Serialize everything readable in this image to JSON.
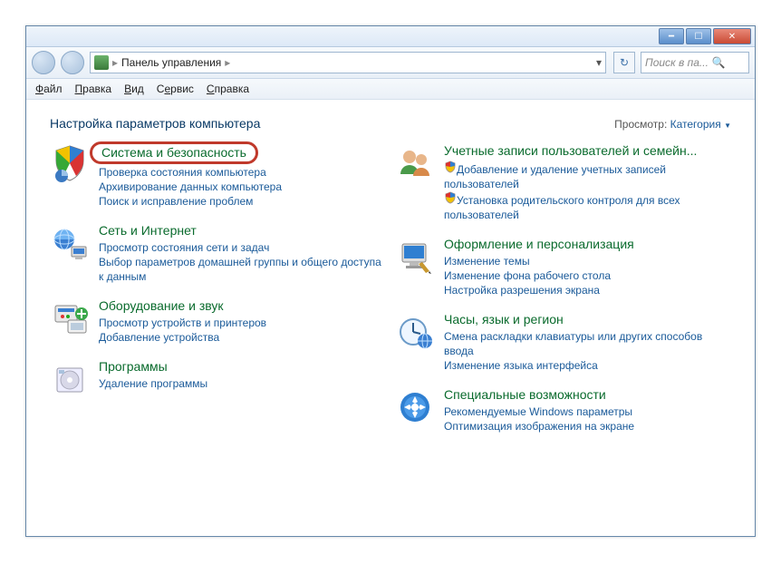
{
  "window": {
    "breadcrumb_root": "Панель управления",
    "search_placeholder": "Поиск в па..."
  },
  "menu": {
    "file": "Файл",
    "edit": "Правка",
    "view": "Вид",
    "tools": "Сервис",
    "help": "Справка"
  },
  "header": {
    "title": "Настройка параметров компьютера",
    "view_label": "Просмотр:",
    "view_value": "Категория"
  },
  "categories": {
    "left": [
      {
        "icon": "shield",
        "title": "Система и безопасность",
        "highlighted": true,
        "links": [
          "Проверка состояния компьютера",
          "Архивирование данных компьютера",
          "Поиск и исправление проблем"
        ]
      },
      {
        "icon": "network",
        "title": "Сеть и Интернет",
        "links": [
          "Просмотр состояния сети и задач",
          "Выбор параметров домашней группы и общего доступа к данным"
        ]
      },
      {
        "icon": "hardware",
        "title": "Оборудование и звук",
        "links": [
          "Просмотр устройств и принтеров",
          "Добавление устройства"
        ]
      },
      {
        "icon": "programs",
        "title": "Программы",
        "links": [
          "Удаление программы"
        ]
      }
    ],
    "right": [
      {
        "icon": "users",
        "title": "Учетные записи пользователей и семейн...",
        "links_shield": [
          "Добавление и удаление учетных записей пользователей",
          "Установка родительского контроля для всех пользователей"
        ]
      },
      {
        "icon": "appearance",
        "title": "Оформление и персонализация",
        "links": [
          "Изменение темы",
          "Изменение фона рабочего стола",
          "Настройка разрешения экрана"
        ]
      },
      {
        "icon": "clock",
        "title": "Часы, язык и регион",
        "links": [
          "Смена раскладки клавиатуры или других способов ввода",
          "Изменение языка интерфейса"
        ]
      },
      {
        "icon": "ease",
        "title": "Специальные возможности",
        "links": [
          "Рекомендуемые Windows параметры",
          "Оптимизация изображения на экране"
        ]
      }
    ]
  }
}
